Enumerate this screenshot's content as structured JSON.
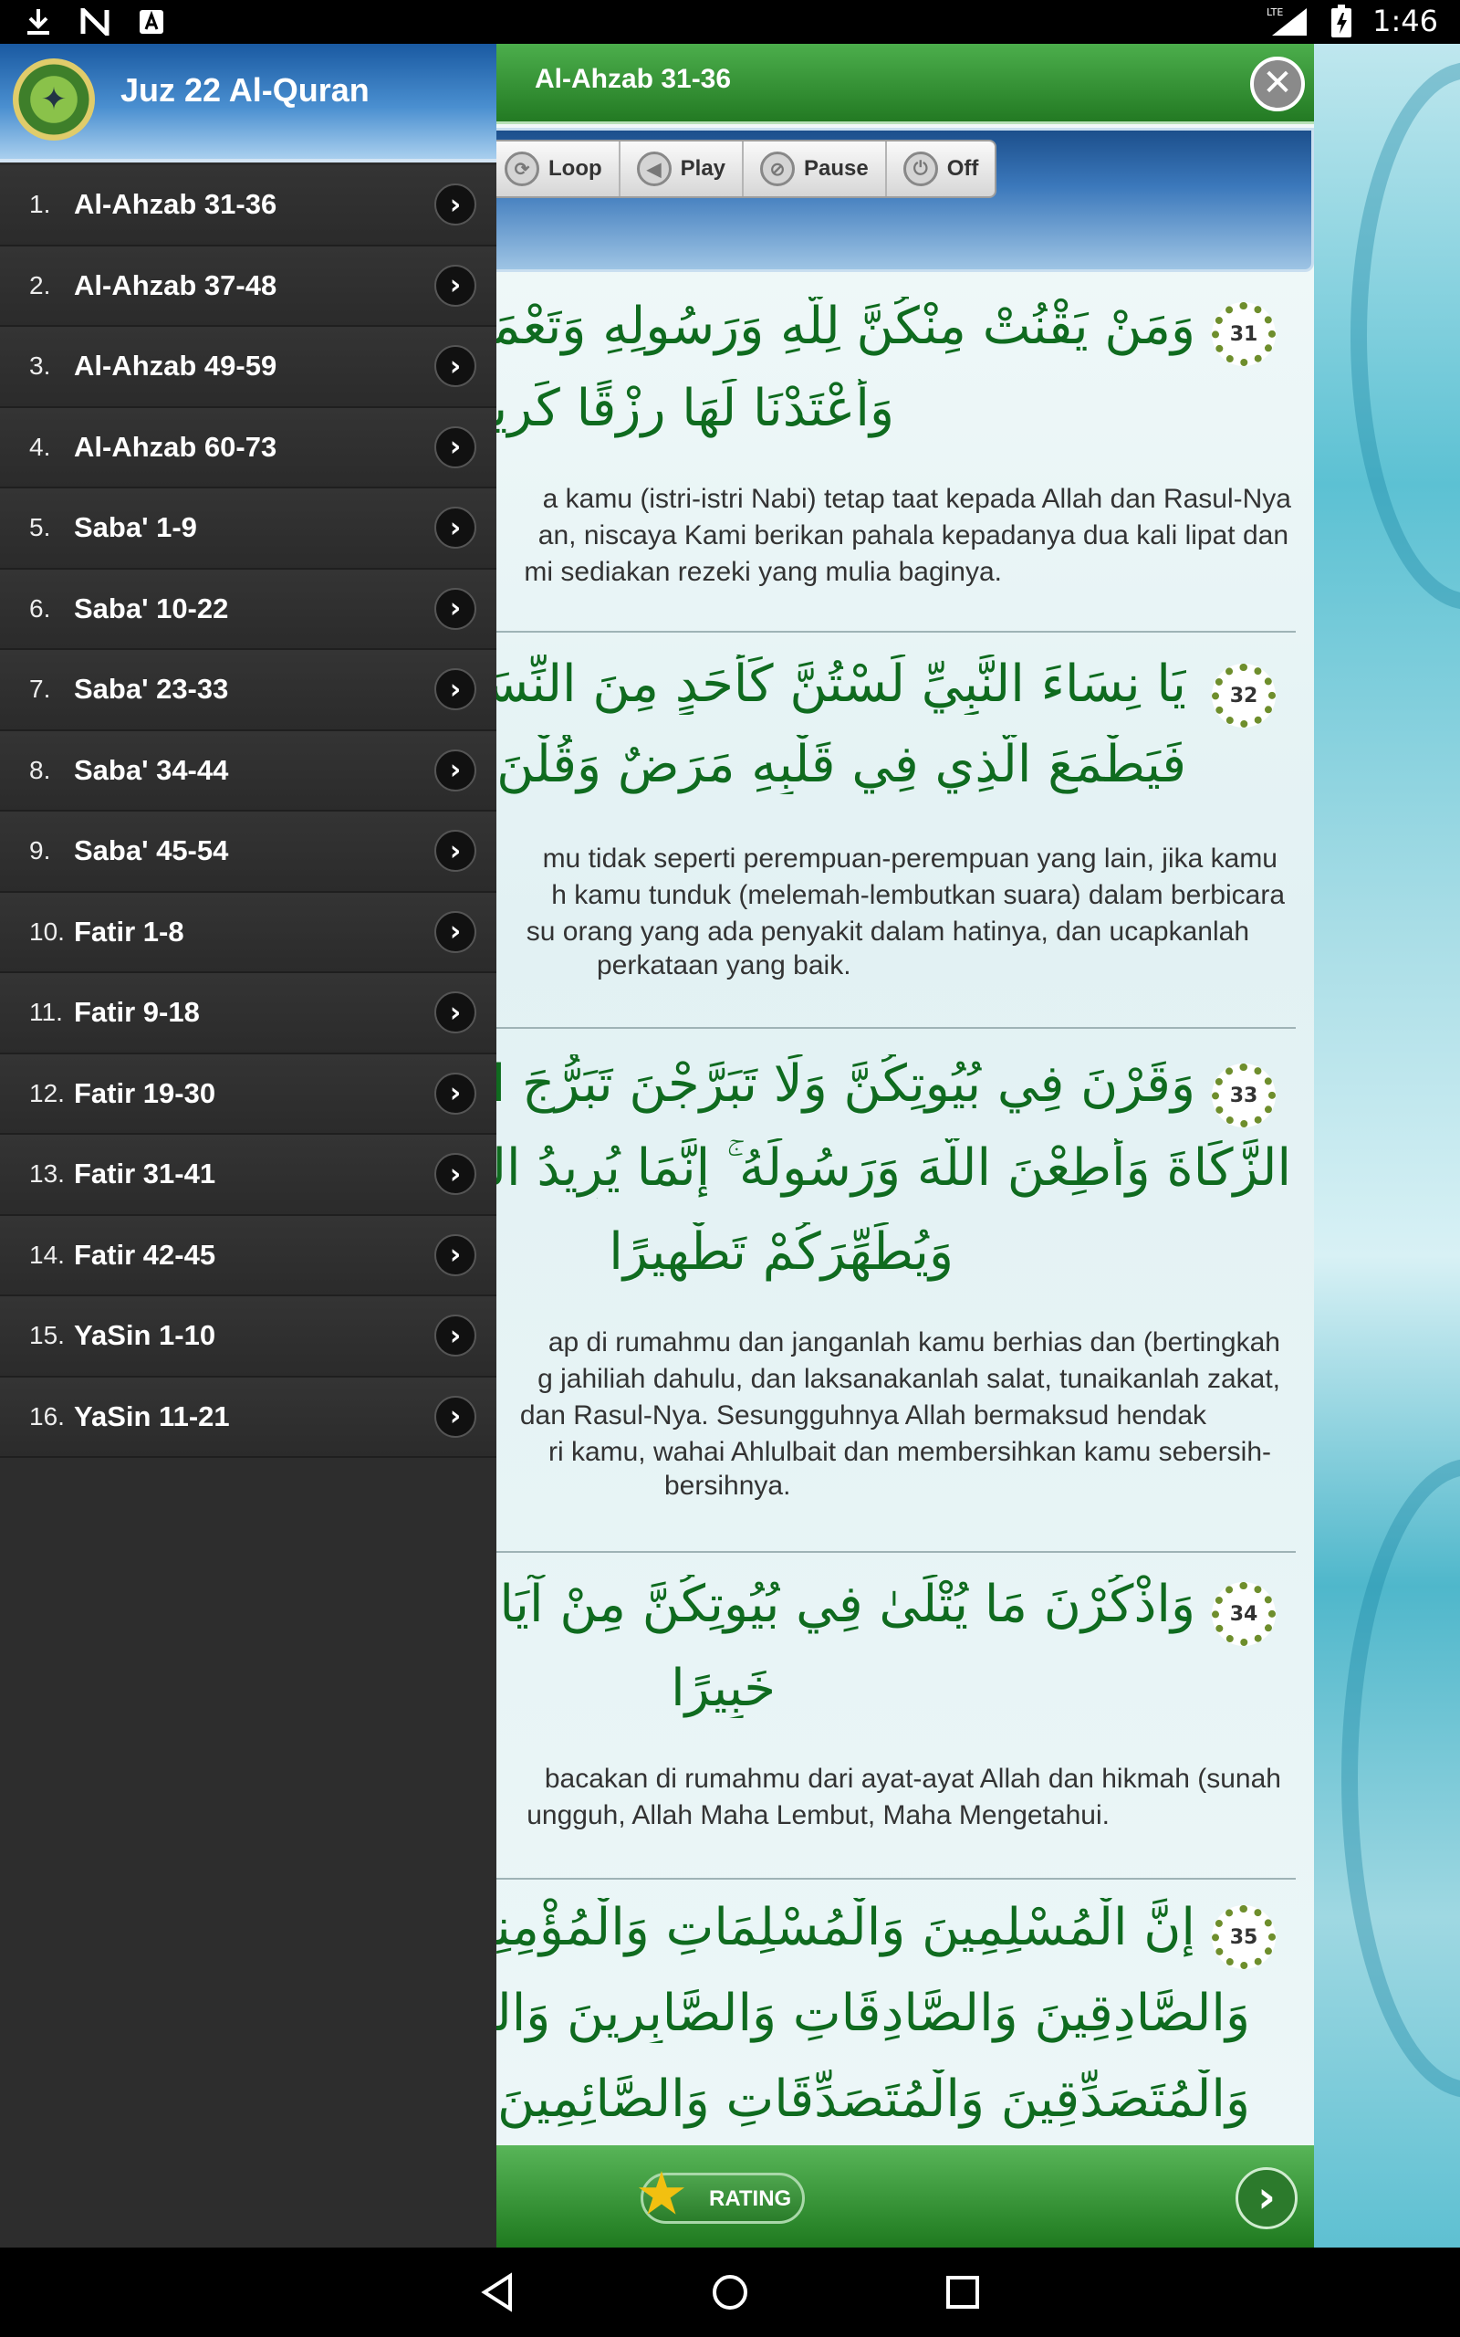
{
  "status_bar": {
    "left_icons": [
      "download-icon",
      "n-notification-icon",
      "a-notification-icon"
    ],
    "network": "LTE",
    "battery": "battery-charging-icon",
    "time": "1:46"
  },
  "drawer": {
    "title": "Juz 22 Al-Quran",
    "items": [
      {
        "num": "1.",
        "label": "Al-Ahzab 31-36"
      },
      {
        "num": "2.",
        "label": "Al-Ahzab 37-48"
      },
      {
        "num": "3.",
        "label": "Al-Ahzab 49-59"
      },
      {
        "num": "4.",
        "label": "Al-Ahzab 60-73"
      },
      {
        "num": "5.",
        "label": "Saba' 1-9"
      },
      {
        "num": "6.",
        "label": "Saba' 10-22"
      },
      {
        "num": "7.",
        "label": "Saba' 23-33"
      },
      {
        "num": "8.",
        "label": "Saba' 34-44"
      },
      {
        "num": "9.",
        "label": "Saba' 45-54"
      },
      {
        "num": "10.",
        "label": "Fatir 1-8"
      },
      {
        "num": "11.",
        "label": "Fatir 9-18"
      },
      {
        "num": "12.",
        "label": "Fatir 19-30"
      },
      {
        "num": "13.",
        "label": "Fatir 31-41"
      },
      {
        "num": "14.",
        "label": "Fatir 42-45"
      },
      {
        "num": "15.",
        "label": "YaSin 1-10"
      },
      {
        "num": "16.",
        "label": "YaSin 11-21"
      }
    ]
  },
  "main": {
    "title": "Al-Ahzab 31-36",
    "controls": {
      "loop": "Loop",
      "play": "Play",
      "pause": "Pause",
      "off": "Off"
    },
    "verses": [
      {
        "number": "31",
        "arabic": [
          "وَمَنْ يَقْنُتْ مِنْكُنَّ لِلَّهِ وَرَسُولِهِ وَتَعْمَلْ صَالِحًا",
          "وَأَعْتَدْنَا لَهَا رِزْقًا كَرِيمًا"
        ],
        "translation": [
          "a kamu (istri-istri Nabi) tetap taat kepada Allah dan Rasul-Nya",
          "an, niscaya Kami berikan pahala kepadanya dua kali lipat dan",
          "mi sediakan rezeki yang mulia baginya."
        ]
      },
      {
        "number": "32",
        "arabic": [
          "يَا نِسَاءَ النَّبِيِّ لَسْتُنَّ كَأَحَدٍ مِنَ النِّسَاءِ ۚ إِنِ اتَّقَيْتُنَّ",
          "فَيَطْمَعَ الَّذِي فِي قَلْبِهِ مَرَضٌ وَقُلْنَ قَوْلًا مَعْ"
        ],
        "translation": [
          "mu tidak seperti perempuan-perempuan yang lain, jika kamu",
          "h kamu tunduk (melemah-lembutkan suara) dalam berbicara",
          "su orang yang ada penyakit dalam hatinya, dan ucapkanlah"
        ],
        "translation_last": "perkataan yang baik."
      },
      {
        "number": "33",
        "arabic": [
          "وَقَرْنَ فِي بُيُوتِكُنَّ وَلَا تَبَرَّجْنَ تَبَرُّجَ الْجَاهِلِيَّةِ الْأُولَىٰ",
          "الزَّكَاةَ وَأَطِعْنَ اللَّهَ وَرَسُولَهُ ۚ إِنَّمَا يُرِيدُ اللَّهُ لِيُذْهِبَ عَنْكُمُ",
          "وَيُطَهِّرَكُمْ تَطْهِيرًا"
        ],
        "translation": [
          "ap di rumahmu dan janganlah kamu berhias dan (bertingkah",
          "g jahiliah dahulu, dan laksanakanlah salat, tunaikanlah zakat,",
          "dan Rasul-Nya. Sesungguhnya Allah bermaksud hendak",
          "ri kamu, wahai Ahlulbait dan membersihkan kamu sebersih-"
        ],
        "translation_last": "bersihnya."
      },
      {
        "number": "34",
        "arabic": [
          "وَاذْكُرْنَ مَا يُتْلَىٰ فِي بُيُوتِكُنَّ مِنْ آيَاتِ اللَّهِ وَالْحِكْ",
          "خَبِيرًا"
        ],
        "translation": [
          "bacakan di rumahmu dari ayat-ayat Allah dan hikmah (sunah",
          "ungguh, Allah Maha Lembut, Maha Mengetahui."
        ]
      },
      {
        "number": "35",
        "arabic": [
          "إِنَّ الْمُسْلِمِينَ وَالْمُسْلِمَاتِ وَالْمُؤْمِنِينَ وَالْمُؤْمِنَاتِ",
          "وَالصَّادِقِينَ وَالصَّادِقَاتِ وَالصَّابِرِينَ وَالصَّابِرَاتِ وَالْخَا",
          "وَالْمُتَصَدِّقِينَ وَالْمُتَصَدِّقَاتِ وَالصَّائِمِينَ وَالصَّائِمَاتِ"
        ]
      }
    ],
    "rating_label": "RATING"
  }
}
